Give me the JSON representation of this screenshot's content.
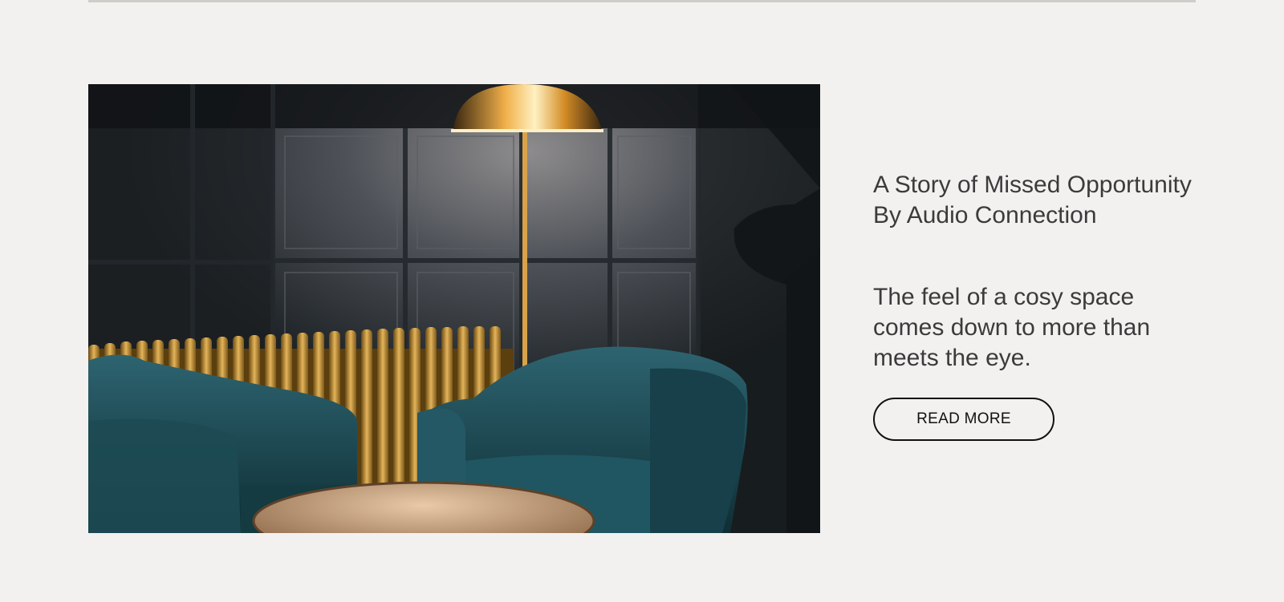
{
  "article": {
    "title_line1": "A Story of Missed Opportunity",
    "title_line2": "By Audio Connection",
    "excerpt": "The feel of a cosy space comes down to more than meets the eye.",
    "cta_label": "READ MORE"
  },
  "colors": {
    "background": "#f2f1ef",
    "text": "#3b3b3b",
    "button_border": "#111111"
  }
}
